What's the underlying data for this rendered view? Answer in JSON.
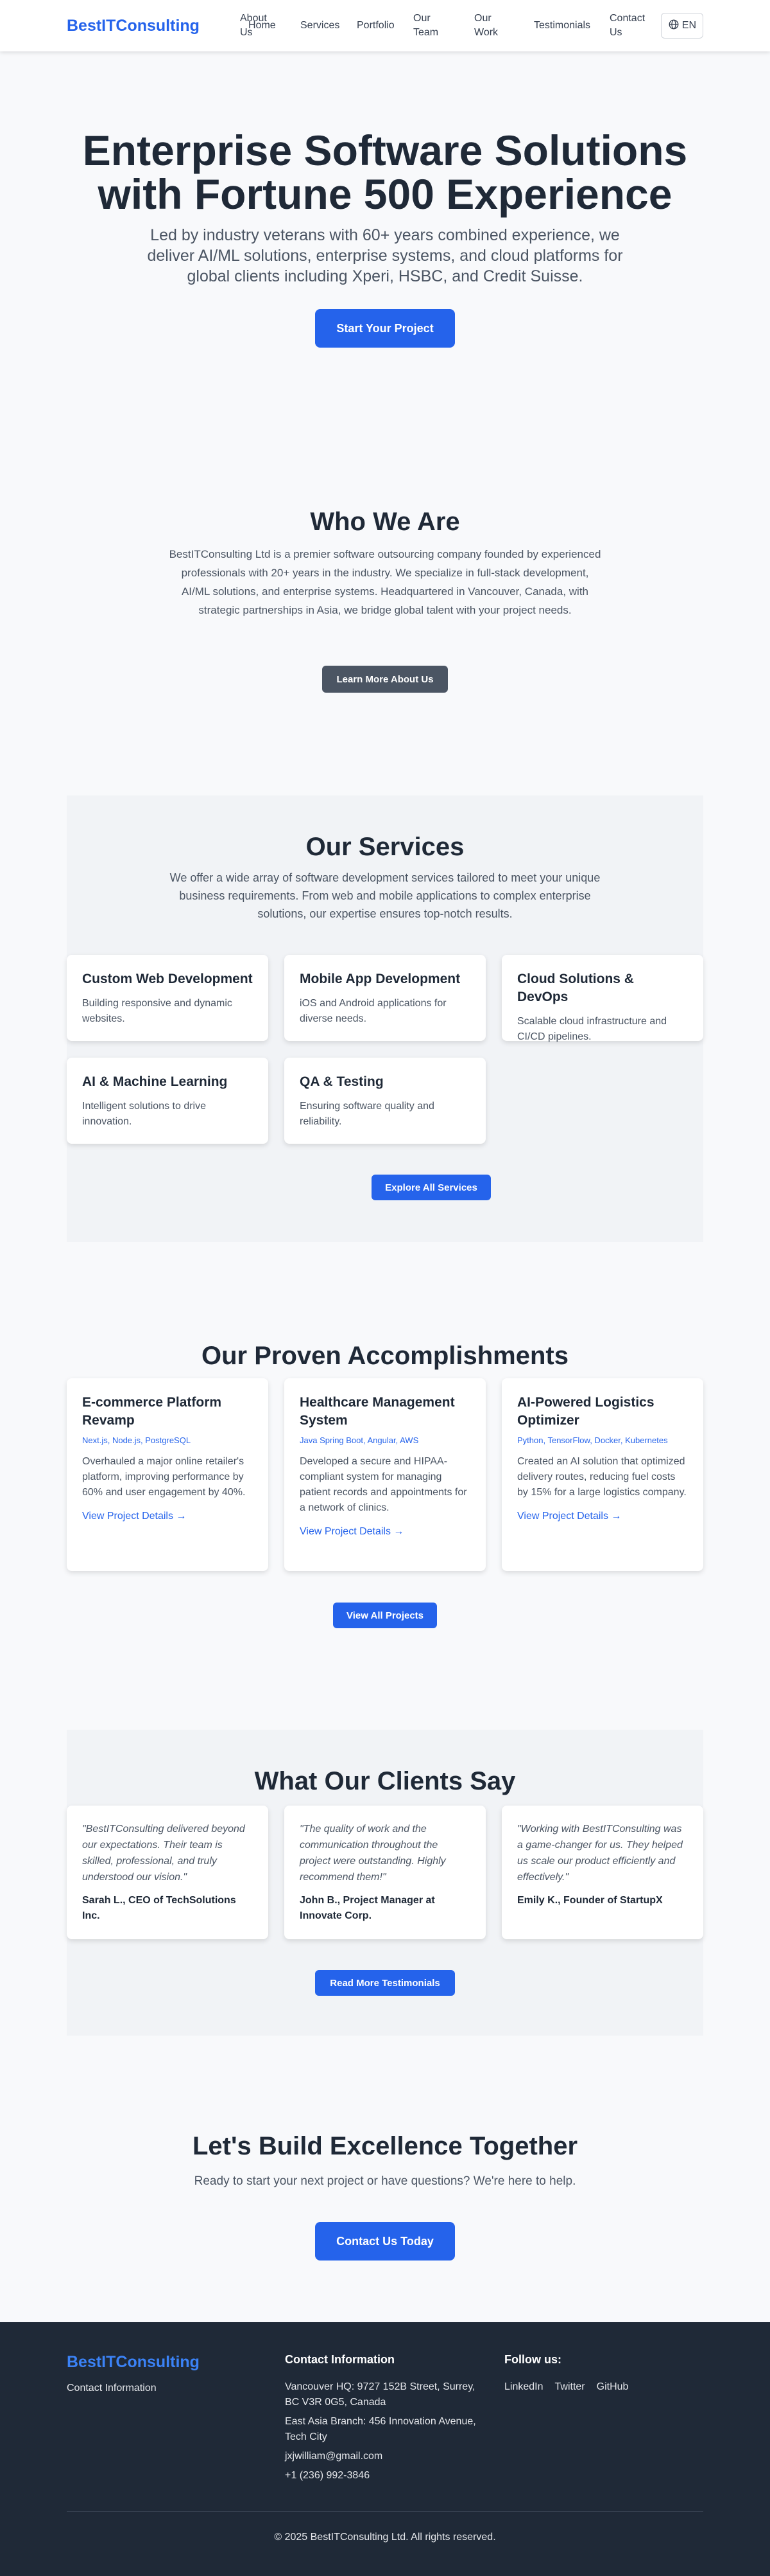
{
  "header": {
    "brand": "BestITConsulting",
    "nav": [
      {
        "label": "Home",
        "name": "nav-home"
      },
      {
        "label": "About Us",
        "name": "nav-about-us"
      },
      {
        "label": "Services",
        "name": "nav-services"
      },
      {
        "label": "Portfolio",
        "name": "nav-portfolio"
      },
      {
        "label": "Our Team",
        "name": "nav-our-team"
      },
      {
        "label": "Our Work",
        "name": "nav-our-work"
      },
      {
        "label": "Testimonials",
        "name": "nav-testimonials"
      },
      {
        "label": "Contact Us",
        "name": "nav-contact-us"
      }
    ],
    "language": "EN"
  },
  "hero": {
    "title": "Enterprise Software Solutions with Fortune 500 Experience",
    "subtitle": "Led by industry veterans with 60+ years combined experience, we deliver AI/ML solutions, enterprise systems, and cloud platforms for global clients including Xperi, HSBC, and Credit Suisse.",
    "cta": "Start Your Project"
  },
  "who": {
    "title": "Who We Are",
    "text": "BestITConsulting Ltd is a premier software outsourcing company founded by experienced professionals with 20+ years in the industry. We specialize in full-stack development, AI/ML solutions, and enterprise systems. Headquartered in Vancouver, Canada, with strategic partnerships in Asia, we bridge global talent with your project needs.",
    "button": "Learn More About Us"
  },
  "services": {
    "title": "Our Services",
    "intro": "We offer a wide array of software development services tailored to meet your unique business requirements. From web and mobile applications to complex enterprise solutions, our expertise ensures top-notch results.",
    "items": [
      {
        "title": "Custom Web Development",
        "text": "Building responsive and dynamic websites."
      },
      {
        "title": "Mobile App Development",
        "text": "iOS and Android applications for diverse needs."
      },
      {
        "title": "Cloud Solutions & DevOps",
        "text": "Scalable cloud infrastructure and CI/CD pipelines."
      },
      {
        "title": "AI & Machine Learning",
        "text": "Intelligent solutions to drive innovation."
      },
      {
        "title": "QA & Testing",
        "text": "Ensuring software quality and reliability."
      }
    ],
    "button": "Explore All Services"
  },
  "accomplishments": {
    "title": "Our Proven Accomplishments",
    "items": [
      {
        "title": "E-commerce Platform Revamp",
        "tech": "Next.js, Node.js, PostgreSQL",
        "text": "Overhauled a major online retailer's platform, improving performance by 60% and user engagement by 40%.",
        "link": "View Project Details →"
      },
      {
        "title": "Healthcare Management System",
        "tech": "Java Spring Boot, Angular, AWS",
        "text": "Developed a secure and HIPAA-compliant system for managing patient records and appointments for a network of clinics.",
        "link": "View Project Details →"
      },
      {
        "title": "AI-Powered Logistics Optimizer",
        "tech": "Python, TensorFlow, Docker, Kubernetes",
        "text": "Created an AI solution that optimized delivery routes, reducing fuel costs by 15% for a large logistics company.",
        "link": "View Project Details →"
      }
    ],
    "button": "View All Projects"
  },
  "testimonials": {
    "title": "What Our Clients Say",
    "items": [
      {
        "quote": "\"BestITConsulting delivered beyond our expectations. Their team is skilled, professional, and truly understood our vision.\"",
        "author": "Sarah L., CEO of TechSolutions Inc."
      },
      {
        "quote": "\"The quality of work and the communication throughout the project were outstanding. Highly recommend them!\"",
        "author": "John B., Project Manager at Innovate Corp."
      },
      {
        "quote": "\"Working with BestITConsulting was a game-changer for us. They helped us scale our product efficiently and effectively.\"",
        "author": "Emily K., Founder of StartupX"
      }
    ],
    "button": "Read More Testimonials"
  },
  "cta": {
    "title": "Let's Build Excellence Together",
    "text": "Ready to start your next project or have questions? We're here to help.",
    "button": "Contact Us Today"
  },
  "footer": {
    "brand": "BestITConsulting",
    "contact_link": "Contact Information",
    "contact_heading": "Contact Information",
    "hq": "Vancouver HQ: 9727 152B Street, Surrey, BC V3R 0G5, Canada",
    "branch": "East Asia Branch: 456 Innovation Avenue, Tech City",
    "email": "jxjwilliam@gmail.com",
    "phone": "+1 (236) 992-3846",
    "follow_heading": "Follow us:",
    "social": [
      "LinkedIn",
      "Twitter",
      "GitHub"
    ],
    "copyright": "© 2025 BestITConsulting Ltd. All rights reserved."
  },
  "colors": {
    "primary": "#2563eb",
    "dark": "#1f2937",
    "panel": "#f1f3f6"
  }
}
